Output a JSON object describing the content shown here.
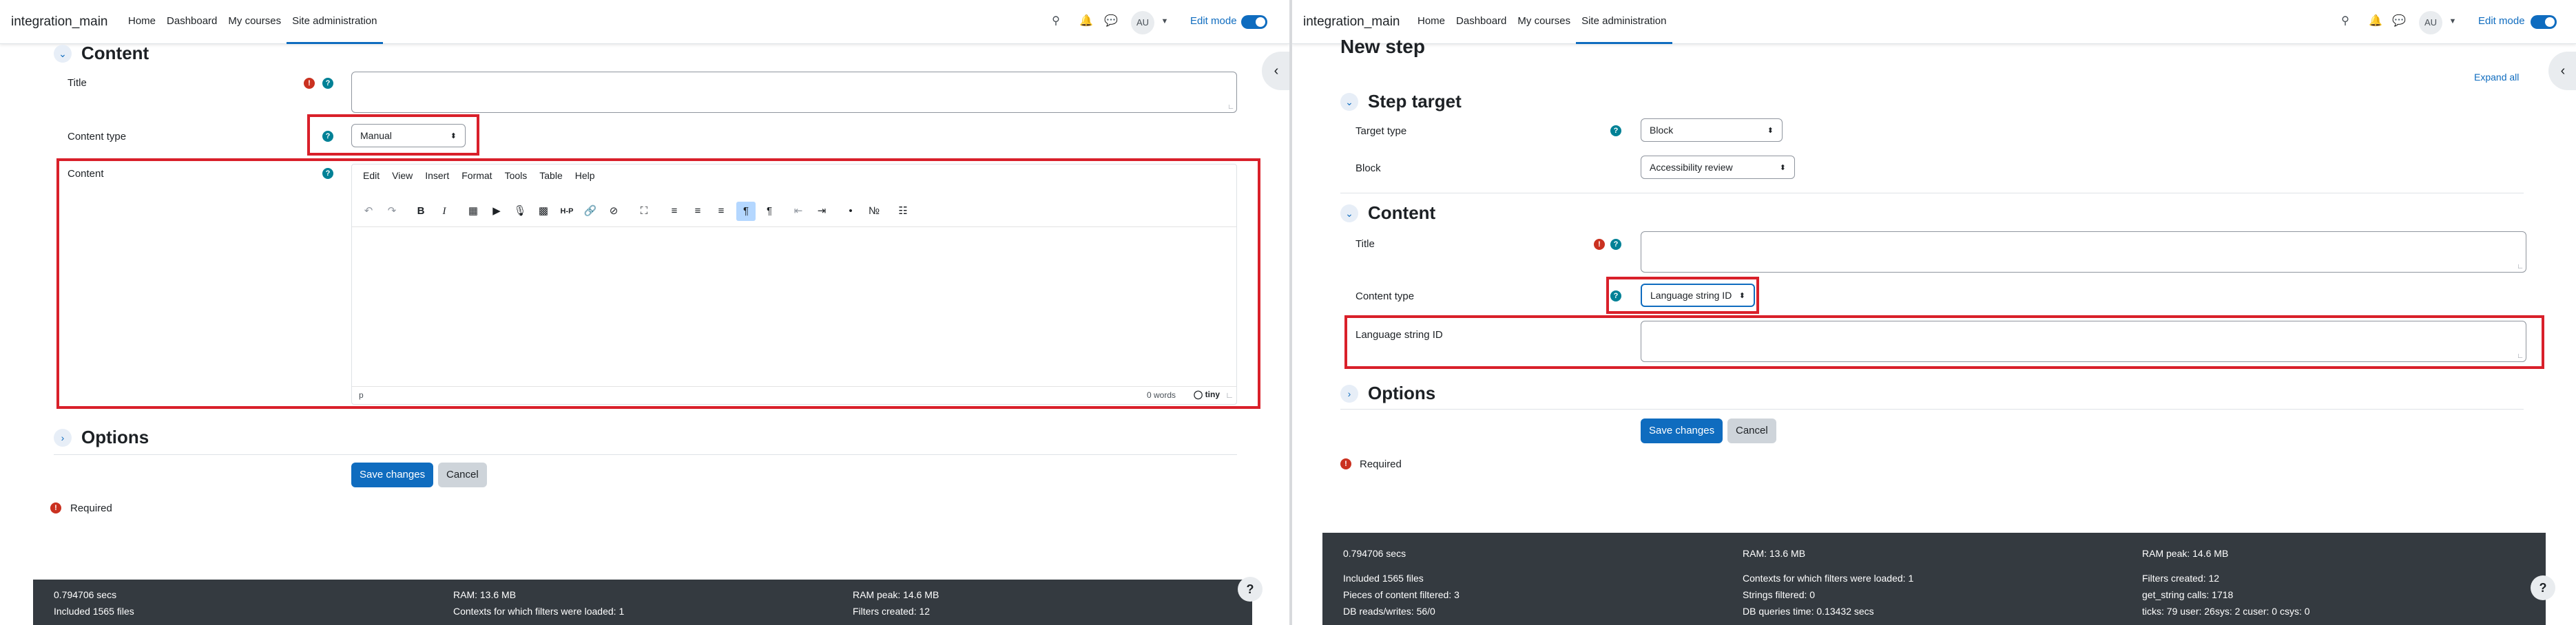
{
  "navbar": {
    "brand": "integration_main",
    "links": [
      "Home",
      "Dashboard",
      "My courses",
      "Site administration"
    ],
    "avatar_initials": "AU",
    "edit_mode_label": "Edit mode"
  },
  "left": {
    "section_content_title": "Content",
    "title_label": "Title",
    "content_type_label": "Content type",
    "content_type_value": "Manual",
    "content_label": "Content",
    "editor_menus": [
      "Edit",
      "View",
      "Insert",
      "Format",
      "Tools",
      "Table",
      "Help"
    ],
    "editor_status_path": "p",
    "editor_word_count": "0 words",
    "editor_brand": "tiny",
    "section_options_title": "Options",
    "save_label": "Save changes",
    "cancel_label": "Cancel",
    "required_label": "Required",
    "footer": {
      "col1": [
        "0.794706 secs",
        "Included 1565 files"
      ],
      "col2": [
        "RAM: 13.6 MB",
        "Contexts for which filters were loaded: 1"
      ],
      "col3": [
        "RAM peak: 14.6 MB",
        "Filters created: 12"
      ]
    }
  },
  "right": {
    "page_heading": "New step",
    "expand_all": "Expand all",
    "section_target_title": "Step target",
    "target_type_label": "Target type",
    "target_type_value": "Block",
    "block_label": "Block",
    "block_value": "Accessibility review",
    "section_content_title": "Content",
    "title_label": "Title",
    "content_type_label": "Content type",
    "content_type_value": "Language string ID",
    "lang_string_label": "Language string ID",
    "section_options_title": "Options",
    "save_label": "Save changes",
    "cancel_label": "Cancel",
    "required_label": "Required",
    "footer": {
      "col1": [
        "0.794706 secs",
        "Included 1565 files",
        "Pieces of content filtered: 3",
        "DB reads/writes: 56/0"
      ],
      "col2": [
        "RAM: 13.6 MB",
        "Contexts for which filters were loaded: 1",
        "Strings filtered: 0",
        "DB queries time: 0.13432 secs"
      ],
      "col3": [
        "RAM peak: 14.6 MB",
        "Filters created: 12",
        "get_string calls: 1718",
        "ticks: 79 user: 26sys: 2 cuser: 0 csys: 0"
      ]
    }
  },
  "icons": {
    "search": "search-icon",
    "bell": "bell-icon",
    "chat": "chat-icon",
    "required": "required-icon",
    "help": "help-icon",
    "chevron": "chevron-icon"
  },
  "colors": {
    "primary": "#0f6cbf",
    "highlight": "#d9202a",
    "required": "#ca3120",
    "help": "#008196",
    "footer": "#343a40"
  }
}
